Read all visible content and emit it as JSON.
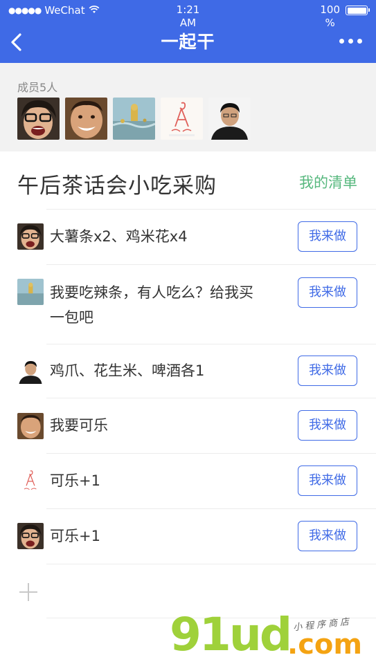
{
  "status_bar": {
    "carrier": "WeChat",
    "time_line1": "1:21",
    "time_line2": "AM",
    "battery_line1": "100",
    "battery_line2": "%",
    "battery_level": 1.0
  },
  "nav": {
    "title": "一起干",
    "back_icon": "chevron-left-icon",
    "more_icon": "more-dots-icon"
  },
  "members": {
    "label": "成员5人",
    "avatars": [
      "avatar-1",
      "avatar-2",
      "avatar-3",
      "avatar-4",
      "avatar-5"
    ]
  },
  "list": {
    "title": "午后茶话会小吃采购",
    "my_list_link": "我的清单",
    "items": [
      {
        "text": "大薯条x2、鸡米花x4",
        "button": "我来做"
      },
      {
        "text": "我要吃辣条，有人吃么？给我买一包吧",
        "button": "我来做"
      },
      {
        "text": "鸡爪、花生米、啤酒各1",
        "button": "我来做"
      },
      {
        "text": "我要可乐",
        "button": "我来做"
      },
      {
        "text": "可乐+1",
        "button": "我来做"
      },
      {
        "text": "可乐+1",
        "button": "我来做"
      }
    ],
    "add_icon": "plus-icon"
  },
  "watermark": {
    "main": "91ud",
    "domain": ".com",
    "sub": "小程序商店"
  },
  "colors": {
    "header_bg": "#3f6ae6",
    "accent_green": "#57b87e",
    "button_blue": "#3f6ae6"
  }
}
